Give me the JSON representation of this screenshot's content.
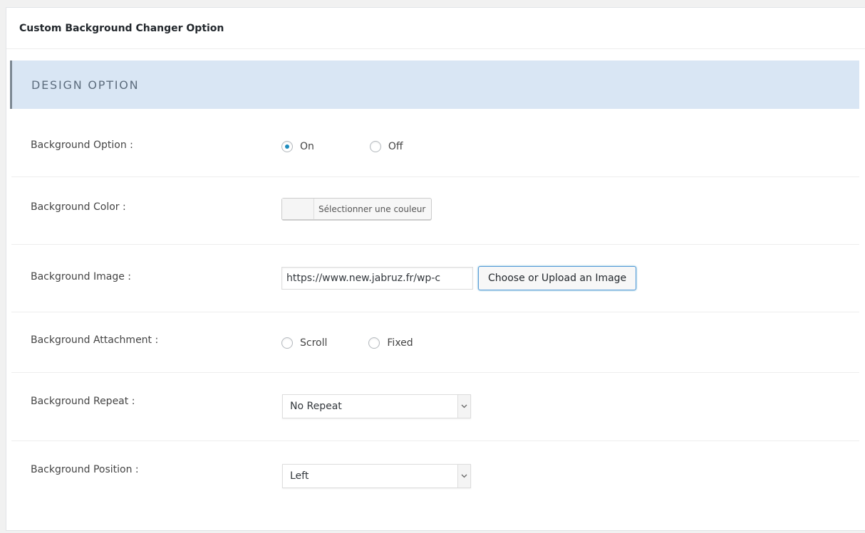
{
  "panel": {
    "title": "Custom Background Changer Option"
  },
  "section": {
    "title": "DESIGN OPTION"
  },
  "rows": {
    "background_option": {
      "label": "Background Option :",
      "options": [
        {
          "label": "On",
          "checked": true
        },
        {
          "label": "Off",
          "checked": false
        }
      ]
    },
    "background_color": {
      "label": "Background Color :",
      "button_label": "Sélectionner une couleur"
    },
    "background_image": {
      "label": "Background Image :",
      "value": "https://www.new.jabruz.fr/wp-c",
      "button_label": "Choose or Upload an Image"
    },
    "background_attachment": {
      "label": "Background Attachment :",
      "options": [
        {
          "label": "Scroll",
          "checked": false
        },
        {
          "label": "Fixed",
          "checked": false
        }
      ]
    },
    "background_repeat": {
      "label": "Background Repeat :",
      "selected": "No Repeat"
    },
    "background_position": {
      "label": "Background Position :",
      "selected": "Left"
    }
  },
  "colors": {
    "accent": "#1e8cbe",
    "section_band": "#d9e6f4",
    "focus_border": "#5b9dd9"
  },
  "icons": {
    "select_arrow": "chevron-down-icon"
  }
}
